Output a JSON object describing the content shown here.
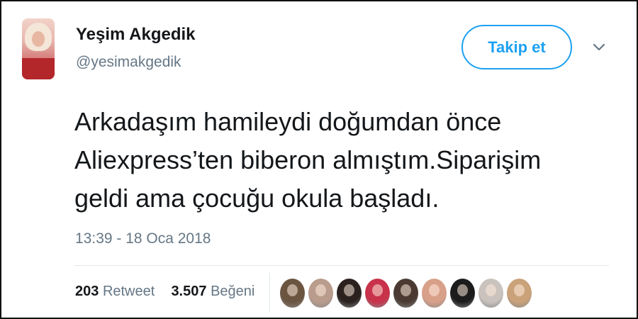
{
  "user": {
    "name": "Yeşim Akgedik",
    "handle": "@yesimakgedik"
  },
  "follow_button": {
    "label": "Takip et"
  },
  "tweet": {
    "lines": [
      "Arkadaşım hamileydi doğumdan önce",
      "Aliexpress’ten biberon almıştım.Siparişim",
      "geldi ama çocuğu okula başladı."
    ],
    "timestamp": "13:39 - 18 Oca 2018"
  },
  "stats": {
    "retweets_count": "203",
    "retweets_label": "Retweet",
    "likes_count": "3.507",
    "likes_label": "Beğeni"
  },
  "colors": {
    "accent": "#1da1f2",
    "secondary_text": "#657786",
    "primary_text": "#14171a"
  },
  "likers": [
    {
      "icon": "liker-avatar-1",
      "color": "#6b5440"
    },
    {
      "icon": "liker-avatar-2",
      "color": "#b99c8c"
    },
    {
      "icon": "liker-avatar-3",
      "color": "#2b2220"
    },
    {
      "icon": "liker-avatar-4",
      "color": "#c8324a"
    },
    {
      "icon": "liker-avatar-5",
      "color": "#4a3a32"
    },
    {
      "icon": "liker-avatar-6",
      "color": "#d9a089"
    },
    {
      "icon": "liker-avatar-7",
      "color": "#1c1c1c"
    },
    {
      "icon": "liker-avatar-8",
      "color": "#c9c2bd"
    },
    {
      "icon": "liker-avatar-9",
      "color": "#caa27a"
    }
  ]
}
